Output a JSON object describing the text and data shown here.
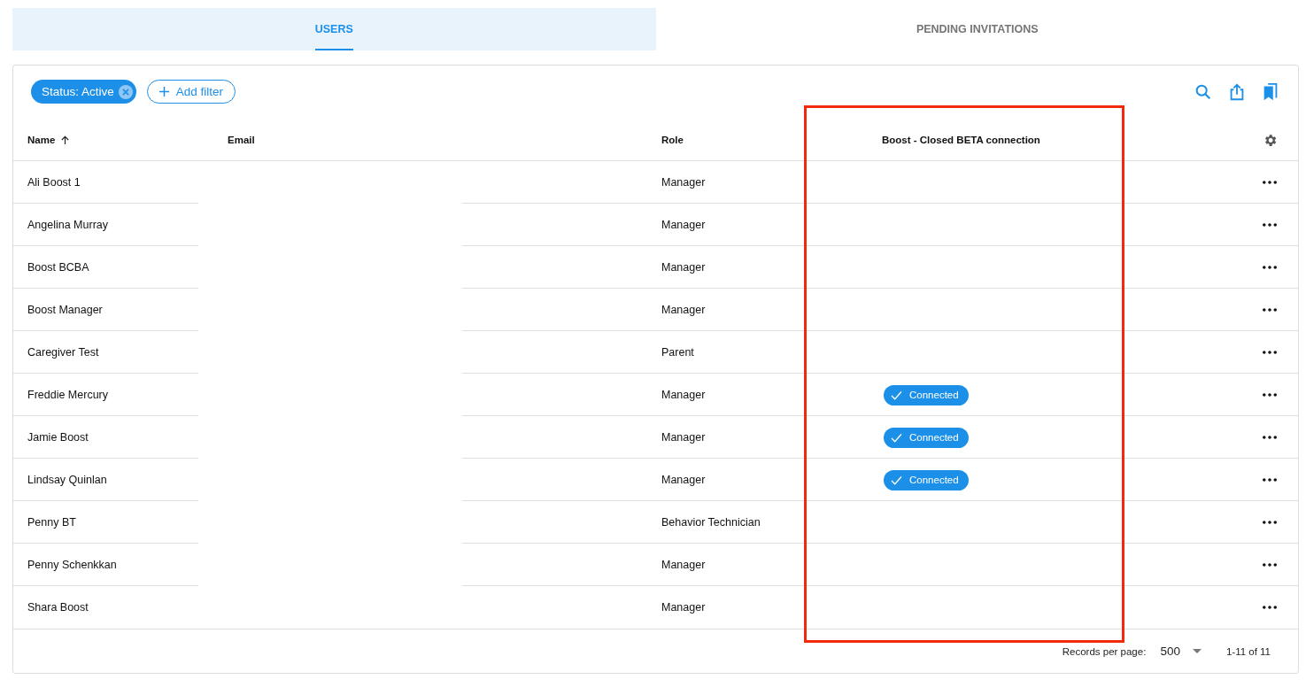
{
  "tabs": [
    {
      "label": "USERS",
      "selected": true
    },
    {
      "label": "PENDING INVITATIONS",
      "selected": false
    }
  ],
  "filters": {
    "chips": [
      {
        "label": "Status: Active"
      }
    ],
    "add_filter": "Add filter"
  },
  "table": {
    "columns": [
      {
        "label": "Name",
        "sorted_ascending": true
      },
      {
        "label": "Email"
      },
      {
        "label": "Role"
      },
      {
        "label": "Boost - Closed BETA connection"
      }
    ],
    "rows": [
      {
        "name": "Ali Boost 1",
        "role": "Manager"
      },
      {
        "name": "Angelina Murray",
        "role": "Manager"
      },
      {
        "name": "Boost BCBA",
        "role": "Manager"
      },
      {
        "name": "Boost Manager",
        "role": "Manager"
      },
      {
        "name": "Caregiver Test",
        "role": "Parent"
      },
      {
        "name": "Freddie Mercury",
        "role": "Manager",
        "connection": "Connected"
      },
      {
        "name": "Jamie Boost",
        "role": "Manager",
        "connection": "Connected"
      },
      {
        "name": "Lindsay Quinlan",
        "role": "Manager",
        "connection": "Connected"
      },
      {
        "name": "Penny BT",
        "role": "Behavior Technician"
      },
      {
        "name": "Penny Schenkkan",
        "role": "Manager"
      },
      {
        "name": "Shara Boost",
        "role": "Manager"
      }
    ]
  },
  "footer": {
    "records_label": "Records per page:",
    "page_size": "500",
    "range": "1-11 of 11"
  }
}
